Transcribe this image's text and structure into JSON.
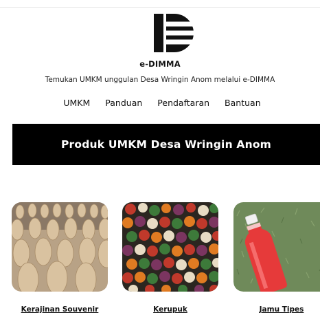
{
  "brand": {
    "name": "e-DIMMA",
    "tagline": "Temukan UMKM unggulan Desa Wringin Anom melalui e-DIMMA"
  },
  "nav": {
    "items": [
      "UMKM",
      "Panduan",
      "Pendaftaran",
      "Bantuan"
    ]
  },
  "banner": {
    "title": "Produk UMKM Desa Wringin Anom"
  },
  "products": [
    {
      "label": "Kerajinan Souvenir"
    },
    {
      "label": "Kerupuk"
    },
    {
      "label": "Jamu Tipes"
    }
  ],
  "colors": {
    "banner_bg": "#000000",
    "banner_text": "#ffffff"
  }
}
